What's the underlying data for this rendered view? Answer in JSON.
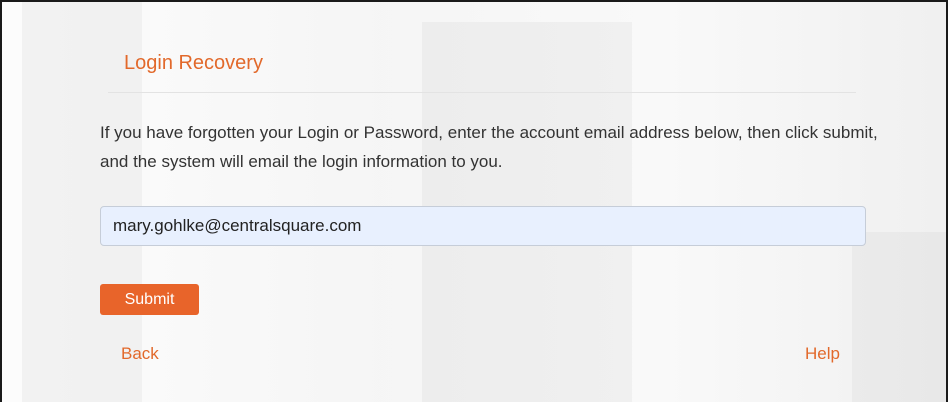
{
  "recovery": {
    "title": "Login Recovery",
    "instructions": "If you have forgotten your Login or Password, enter the account email address below, then click submit, and the system will email the login information to you.",
    "email_value": "mary.gohlke@centralsquare.com",
    "submit_label": "Submit",
    "back_label": "Back",
    "help_label": "Help"
  },
  "colors": {
    "accent": "#e2692b",
    "button": "#e8642a",
    "input_background": "#e8f0fe"
  }
}
